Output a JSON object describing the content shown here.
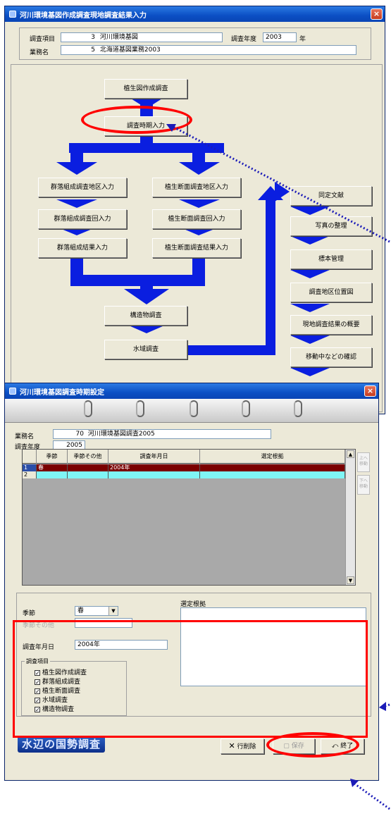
{
  "window_main": {
    "title": "河川環境基図作成調査現地調査結果入力",
    "close_glyph": "×",
    "survey_item_label": "調査項目",
    "survey_item_code": "3",
    "survey_item_name": "河川環境基図",
    "survey_year_label": "調査年度",
    "survey_year_value": "2003",
    "year_unit": "年",
    "project_label": "業務名",
    "project_code": "5",
    "project_name": "北海道基図業務2003",
    "flow_buttons": {
      "veg_map": "植生図作成調査",
      "survey_period": "調査時期入力",
      "community_area": "群落組成調査地区入力",
      "community_round": "群落組成調査回入力",
      "community_result": "群落組成結果入力",
      "transect_area": "植生断面調査地区入力",
      "transect_round": "植生断面調査回入力",
      "transect_result": "植生断面調査結果入力",
      "structure": "構造物調査",
      "water_area": "水域調査",
      "literature": "同定文献",
      "photos": "写真の整理",
      "specimens": "標本管理",
      "area_map": "調査地区位置図",
      "summary": "現地調査結果の概要",
      "moving_check": "移動中などの確認"
    }
  },
  "window_period": {
    "title": "河川環境基図調査時期設定",
    "close_glyph": "×",
    "project_label": "業務名",
    "project_code": "70",
    "project_name": "河川環境基図調査2005",
    "year_label": "調査年度",
    "year_value": "2005",
    "grid": {
      "headers": [
        "季節",
        "季節その他",
        "調査年月日",
        "選定根拠"
      ],
      "rows": [
        {
          "no": "1",
          "season": "春",
          "season_other": "",
          "date": "2004年",
          "basis": ""
        },
        {
          "no": "2",
          "season": "",
          "season_other": "",
          "date": "",
          "basis": ""
        }
      ],
      "up_button": "上へ移動",
      "down_button": "下へ移動"
    },
    "form": {
      "season_label": "季節",
      "season_value": "春",
      "season_other_label": "季節その他",
      "season_other_value": "",
      "date_label": "調査年月日",
      "date_value": "2004年",
      "basis_label": "選定根拠",
      "basis_value": "",
      "items_label": "調査項目",
      "items": [
        {
          "label": "植生図作成調査",
          "checked": true
        },
        {
          "label": "群落組成調査",
          "checked": true
        },
        {
          "label": "植生断面調査",
          "checked": true
        },
        {
          "label": "水域調査",
          "checked": true
        },
        {
          "label": "構造物調査",
          "checked": true
        }
      ]
    },
    "logo_text": "水辺の国勢調査",
    "delete_row_button": "行削除",
    "save_button": "保存",
    "exit_button": "終了"
  },
  "colors": {
    "flow_arrow": "#0a1ee0",
    "annotation_red": "#ff0000",
    "annotation_dots": "#1c1cb8",
    "selected_row": "#7a0000",
    "new_row": "#7ff5f5"
  }
}
